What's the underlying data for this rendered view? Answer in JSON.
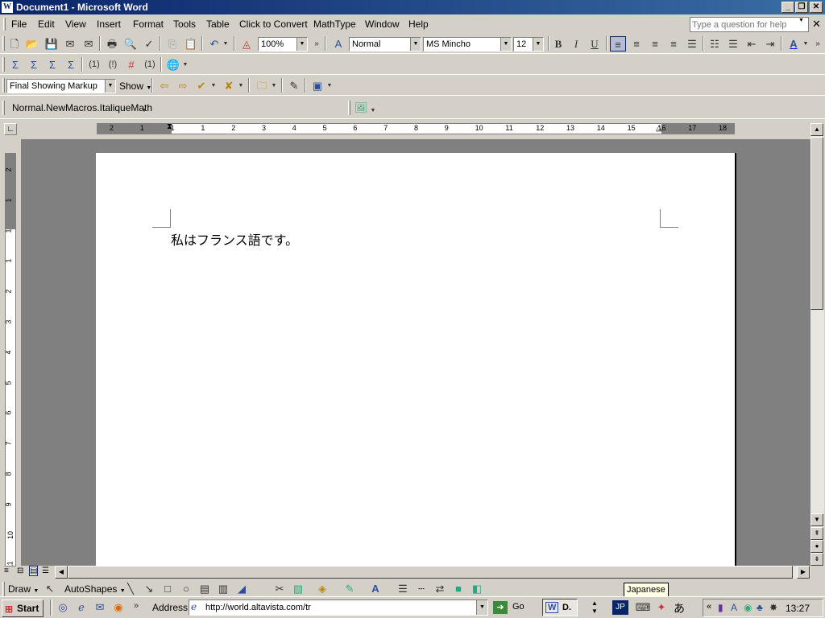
{
  "window": {
    "title": "Document1 - Microsoft Word",
    "app_icon": "W"
  },
  "menubar": {
    "items": [
      "File",
      "Edit",
      "View",
      "Insert",
      "Format",
      "Tools",
      "Table",
      "Click to Convert",
      "MathType",
      "Window",
      "Help"
    ],
    "help_placeholder": "Type a question for help"
  },
  "formatting": {
    "zoom": "100%",
    "style": "Normal",
    "font": "MS Mincho",
    "size": "12",
    "bold": "B",
    "italic": "I",
    "underline": "U",
    "font_color_letter": "A"
  },
  "reviewing": {
    "markup": "Final Showing Markup",
    "show": "Show"
  },
  "macro_toolbar": {
    "label": "Normal.NewMacros.ItaliqueMath"
  },
  "ruler": {
    "h_ticks": [
      "2",
      "1",
      "1",
      "1",
      "2",
      "3",
      "4",
      "5",
      "6",
      "7",
      "8",
      "9",
      "10",
      "11",
      "12",
      "13",
      "14",
      "15",
      "16",
      "17",
      "18"
    ],
    "v_ticks": [
      "2",
      "1",
      "1",
      "1",
      "2",
      "3",
      "4",
      "5",
      "6",
      "7",
      "8",
      "9",
      "10",
      "11"
    ]
  },
  "document": {
    "text": "私はフランス語です。"
  },
  "drawbar": {
    "draw": "Draw",
    "autoshapes": "AutoShapes"
  },
  "tooltip": {
    "text": "Japanese"
  },
  "taskbar": {
    "start": "Start",
    "address_label": "Address",
    "address_value": "http://world.altavista.com/tr",
    "go": "Go",
    "word_task": "D.",
    "lang": "JP",
    "ime": "あ",
    "clock": "13:27"
  }
}
